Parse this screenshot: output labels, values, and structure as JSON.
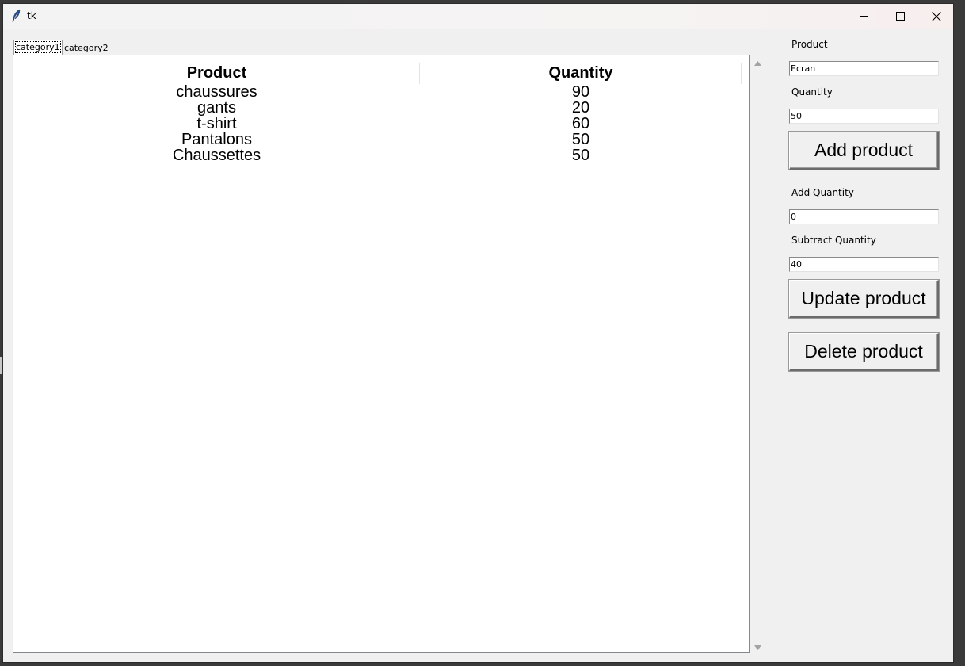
{
  "window": {
    "title": "tk"
  },
  "tabs": [
    {
      "label": "category1",
      "active": true
    },
    {
      "label": "category2",
      "active": false
    }
  ],
  "table": {
    "columns": [
      "Product",
      "Quantity"
    ],
    "rows": [
      {
        "product": "chaussures",
        "quantity": "90"
      },
      {
        "product": "gants",
        "quantity": "20"
      },
      {
        "product": "t-shirt",
        "quantity": "60"
      },
      {
        "product": "Pantalons",
        "quantity": "50"
      },
      {
        "product": "Chaussettes",
        "quantity": "50"
      }
    ]
  },
  "form": {
    "product_label": "Product",
    "product_value": "Ecran",
    "quantity_label": "Quantity",
    "quantity_value": "50",
    "add_button": "Add product",
    "add_quantity_label": "Add Quantity",
    "add_quantity_value": "0",
    "subtract_quantity_label": "Subtract Quantity",
    "subtract_quantity_value": "40",
    "update_button": "Update product",
    "delete_button": "Delete product"
  },
  "icons": {
    "app": "feather-icon",
    "minimize": "minimize-icon",
    "maximize": "maximize-icon",
    "close": "close-icon",
    "scroll_up": "scroll-up-arrow-icon",
    "scroll_down": "scroll-down-arrow-icon"
  }
}
